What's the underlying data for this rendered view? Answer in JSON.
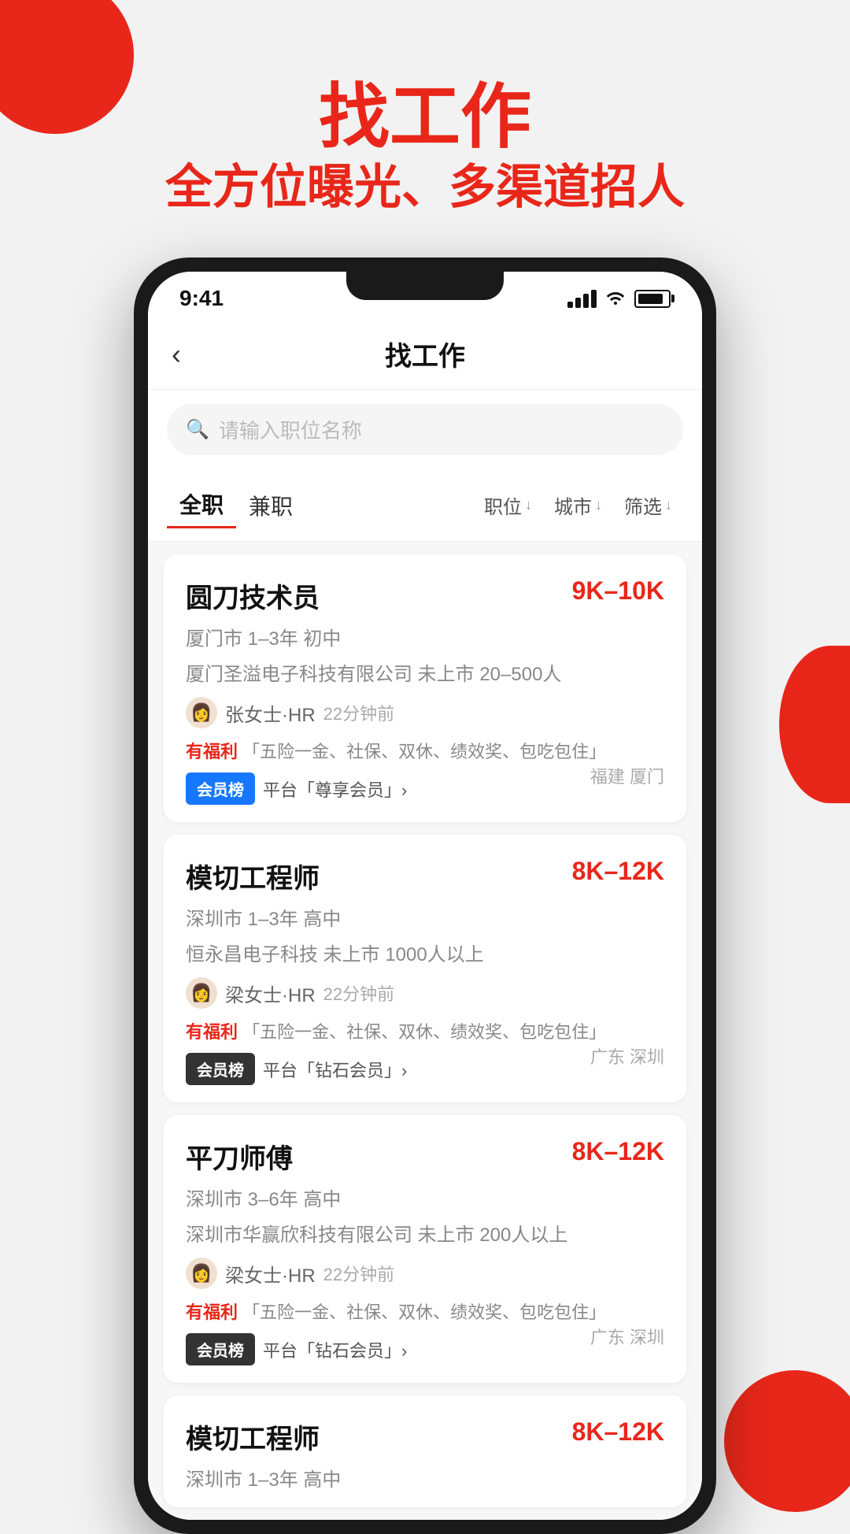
{
  "header": {
    "title": "找工作",
    "subtitle": "全方位曝光、多渠道招人"
  },
  "status_bar": {
    "time": "9:41",
    "signal": "signal",
    "wifi": "wifi",
    "battery": "battery"
  },
  "nav": {
    "back_label": "‹",
    "title": "找工作"
  },
  "search": {
    "placeholder": "请输入职位名称"
  },
  "filter": {
    "tabs": [
      {
        "label": "全职",
        "active": true
      },
      {
        "label": "兼职",
        "active": false
      }
    ],
    "buttons": [
      {
        "label": "职位 ↓"
      },
      {
        "label": "城市 ↓"
      },
      {
        "label": "筛选 ↓"
      }
    ]
  },
  "jobs": [
    {
      "title": "圆刀技术员",
      "salary": "9K–10K",
      "meta": "厦门市  1–3年  初中",
      "company": "厦门圣溢电子科技有限公司  未上市  20–500人",
      "hr_name": "张女士·HR",
      "hr_time": "22分钟前",
      "benefits_label": "有福利",
      "benefits": "「五险一金、社保、双休、绩效奖、包吃包住」",
      "location": "福建 厦门",
      "badge_type": "blue",
      "badge_label": "会员榜",
      "badge_text": "平台「尊享会员」›"
    },
    {
      "title": "模切工程师",
      "salary": "8K–12K",
      "meta": "深圳市  1–3年  高中",
      "company": "恒永昌电子科技  未上市  1000人以上",
      "hr_name": "梁女士·HR",
      "hr_time": "22分钟前",
      "benefits_label": "有福利",
      "benefits": "「五险一金、社保、双休、绩效奖、包吃包住」",
      "location": "广东 深圳",
      "badge_type": "dark",
      "badge_label": "会员榜",
      "badge_text": "平台「钻石会员」›"
    },
    {
      "title": "平刀师傅",
      "salary": "8K–12K",
      "meta": "深圳市  3–6年  高中",
      "company": "深圳市华赢欣科技有限公司  未上市  200人以上",
      "hr_name": "梁女士·HR",
      "hr_time": "22分钟前",
      "benefits_label": "有福利",
      "benefits": "「五险一金、社保、双休、绩效奖、包吃包住」",
      "location": "广东 深圳",
      "badge_type": "dark",
      "badge_label": "会员榜",
      "badge_text": "平台「钻石会员」›"
    },
    {
      "title": "模切工程师",
      "salary": "8K–12K",
      "meta": "深圳市  1–3年  高中",
      "company": "",
      "hr_name": "",
      "hr_time": "",
      "benefits_label": "",
      "benefits": "",
      "location": "",
      "badge_type": "",
      "badge_label": "",
      "badge_text": ""
    }
  ]
}
